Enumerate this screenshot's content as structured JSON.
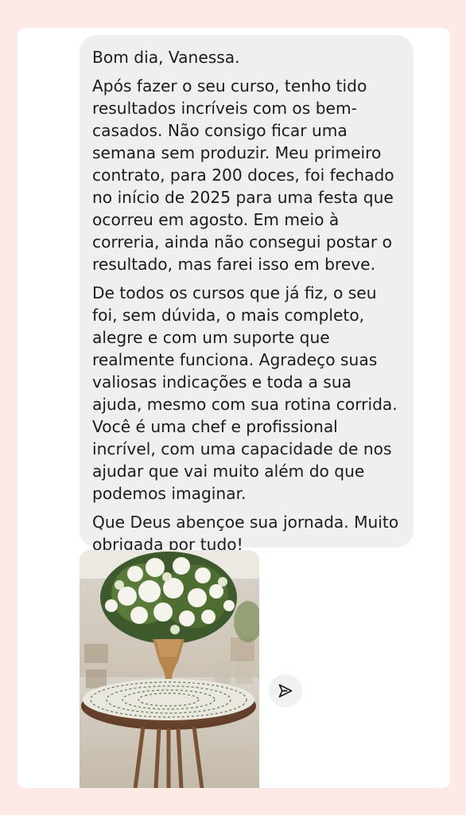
{
  "message": {
    "paragraphs": [
      "Bom dia, Vanessa.",
      "Após fazer o seu curso, tenho tido\nresultados incríveis com os bem-\ncasados. Não consigo ficar uma\nsemana sem produzir. Meu primeiro\ncontrato, para 200 doces, foi fechado\nno início de 2025 para uma festa que\nocorreu em agosto. Em meio à\ncorreria, ainda não consegui postar o\nresultado, mas farei isso em breve.",
      "De todos os cursos que já fiz, o seu\nfoi, sem dúvida, o mais completo,\nalegre e com um suporte que\nrealmente funciona. Agradeço suas\nvaliosas indicações e toda a sua\najuda, mesmo com sua rotina corrida.\nVocê é uma chef e profissional\nincrível, com uma capacidade de nos\najudar que vai muito além do que\npodemos imaginar.",
      "Que Deus abençoe sua jornada. Muito\nobrigada por tudo!"
    ]
  },
  "attachment": {
    "type": "photo"
  },
  "actions": {
    "share_icon": "paper-plane-icon"
  },
  "colors": {
    "page_background": "#fde9e6",
    "bubble_background": "#efeff0",
    "text": "#1c1c1e"
  }
}
